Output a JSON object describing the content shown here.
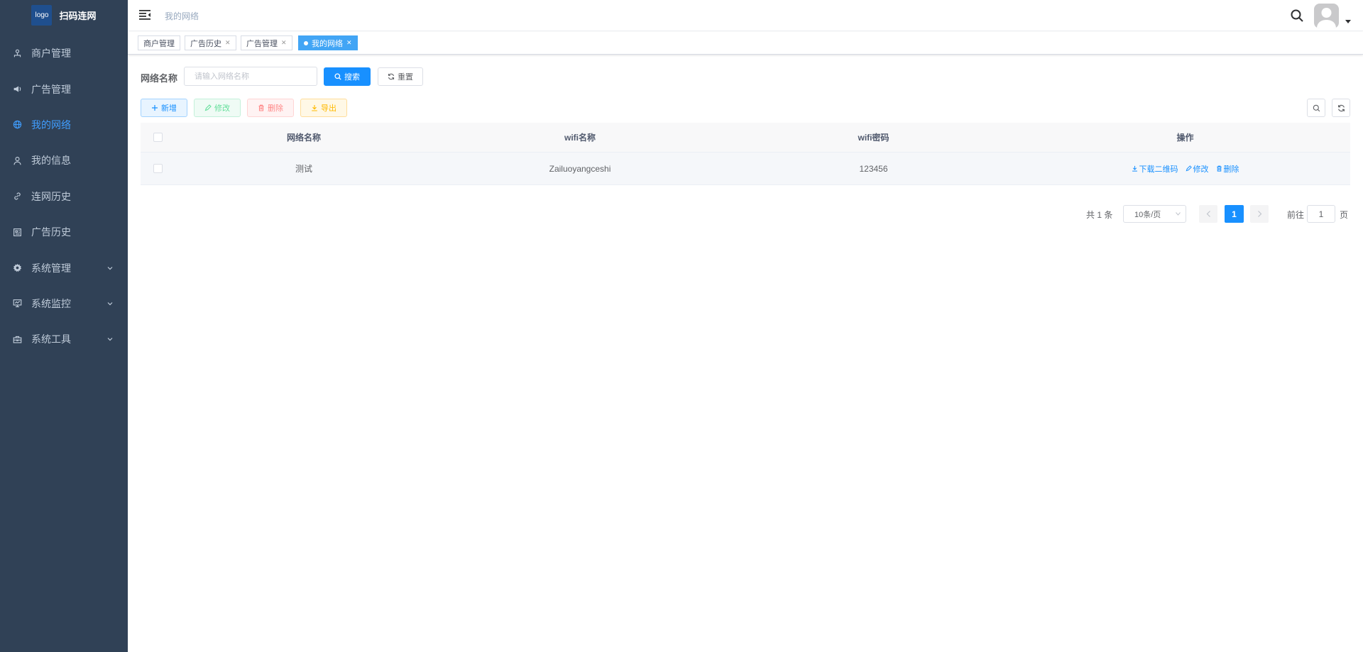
{
  "brand": {
    "logo_text": "logo",
    "title": "扫码连网"
  },
  "sidebar": {
    "items": [
      {
        "label": "商户管理",
        "icon": "merchant-icon",
        "active": false,
        "expandable": false
      },
      {
        "label": "广告管理",
        "icon": "megaphone-icon",
        "active": false,
        "expandable": false
      },
      {
        "label": "我的网络",
        "icon": "globe-icon",
        "active": true,
        "expandable": false
      },
      {
        "label": "我的信息",
        "icon": "user-icon",
        "active": false,
        "expandable": false
      },
      {
        "label": "连网历史",
        "icon": "link-icon",
        "active": false,
        "expandable": false
      },
      {
        "label": "广告历史",
        "icon": "document-icon",
        "active": false,
        "expandable": false
      },
      {
        "label": "系统管理",
        "icon": "gear-icon",
        "active": false,
        "expandable": true
      },
      {
        "label": "系统监控",
        "icon": "monitor-icon",
        "active": false,
        "expandable": true
      },
      {
        "label": "系统工具",
        "icon": "toolbox-icon",
        "active": false,
        "expandable": true
      }
    ]
  },
  "navbar": {
    "breadcrumb": "我的网络"
  },
  "tags": [
    {
      "label": "商户管理",
      "closable": false,
      "active": false
    },
    {
      "label": "广告历史",
      "closable": true,
      "active": false
    },
    {
      "label": "广告管理",
      "closable": true,
      "active": false
    },
    {
      "label": "我的网络",
      "closable": true,
      "active": true
    }
  ],
  "search_form": {
    "label": "网络名称",
    "placeholder": "请输入网络名称",
    "value": "",
    "search_label": "搜索",
    "reset_label": "重置"
  },
  "toolbar": {
    "add_label": "新增",
    "edit_label": "修改",
    "delete_label": "删除",
    "export_label": "导出"
  },
  "table": {
    "columns": [
      "网络名称",
      "wifi名称",
      "wifi密码",
      "操作"
    ],
    "rows": [
      {
        "name": "测试",
        "wifi_name": "Zailuoyangceshi",
        "wifi_password": "123456"
      }
    ],
    "actions": {
      "download_qr": "下载二维码",
      "edit": "修改",
      "delete": "删除"
    }
  },
  "pagination": {
    "total_text": "共 1 条",
    "page_size": "10条/页",
    "current_page": "1",
    "goto_label": "前往",
    "goto_value": "1",
    "unit_label": "页"
  },
  "colors": {
    "sidebar_bg": "#304156",
    "sidebar_text": "#bfcbd9",
    "primary": "#1890ff",
    "active_tag": "#42a5f5"
  }
}
